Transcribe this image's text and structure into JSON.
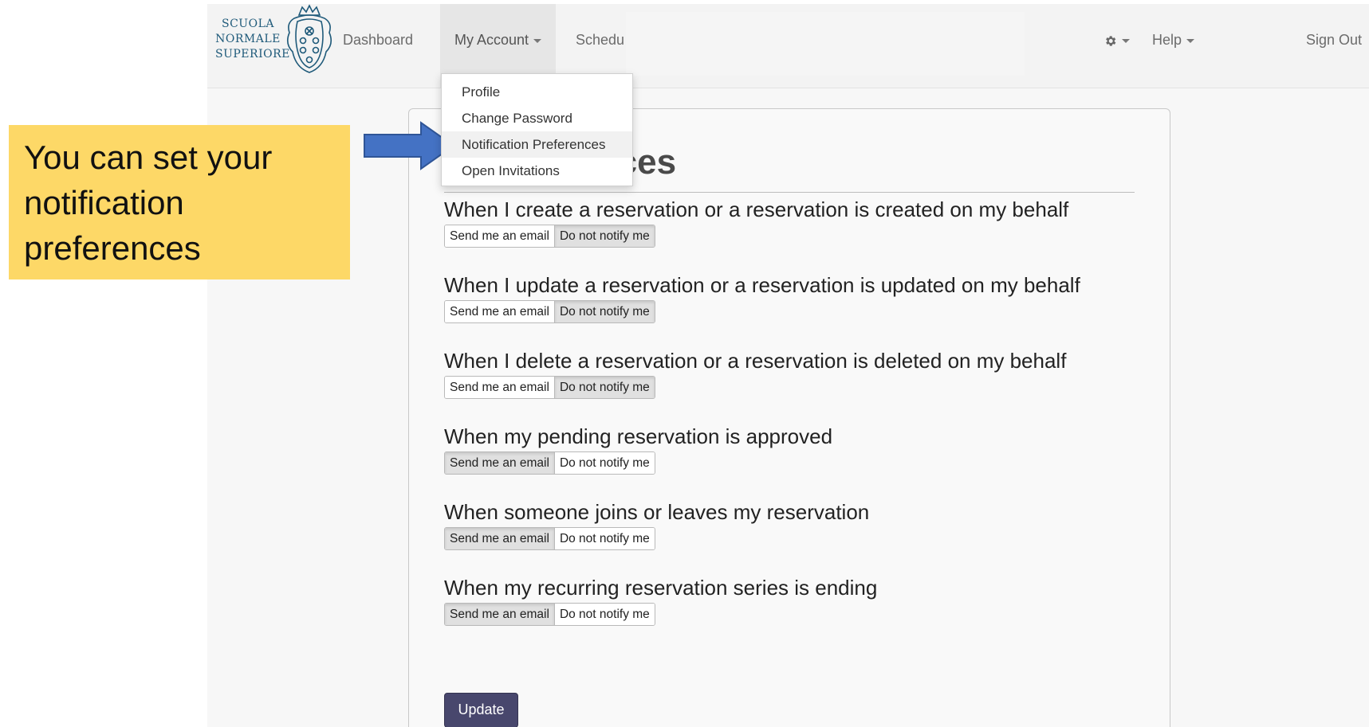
{
  "navbar": {
    "logo_text": [
      "SCUOLA",
      "NORMALE",
      "SUPERIORE"
    ],
    "links": {
      "dashboard": "Dashboard",
      "my_account": "My Account",
      "schedule": "Schedu",
      "help": "Help",
      "sign_out": "Sign Out"
    },
    "settings_icon": "gear-icon"
  },
  "dropdown": {
    "items": [
      "Profile",
      "Change Password",
      "Notification Preferences",
      "Open Invitations"
    ],
    "highlighted_index": 2
  },
  "page": {
    "title": "n Preferences",
    "preferences": [
      {
        "label": "When I create a reservation or a reservation is created on my behalf",
        "options": [
          "Send me an email",
          "Do not notify me"
        ],
        "selected": "Do not notify me"
      },
      {
        "label": "When I update a reservation or a reservation is updated on my behalf",
        "options": [
          "Send me an email",
          "Do not notify me"
        ],
        "selected": "Do not notify me"
      },
      {
        "label": "When I delete a reservation or a reservation is deleted on my behalf",
        "options": [
          "Send me an email",
          "Do not notify me"
        ],
        "selected": "Do not notify me"
      },
      {
        "label": "When my pending reservation is approved",
        "options": [
          "Send me an email",
          "Do not notify me"
        ],
        "selected": "Send me an email"
      },
      {
        "label": "When someone joins or leaves my reservation",
        "options": [
          "Send me an email",
          "Do not notify me"
        ],
        "selected": "Send me an email"
      },
      {
        "label": "When my recurring reservation series is ending",
        "options": [
          "Send me an email",
          "Do not notify me"
        ],
        "selected": "Send me an email"
      }
    ],
    "update_label": "Update"
  },
  "callout": {
    "lines": [
      "You can set your",
      "notification",
      "preferences"
    ]
  },
  "colors": {
    "callout_bg": "#fdd867",
    "arrow": "#4472c4",
    "update_button": "#48476d"
  }
}
